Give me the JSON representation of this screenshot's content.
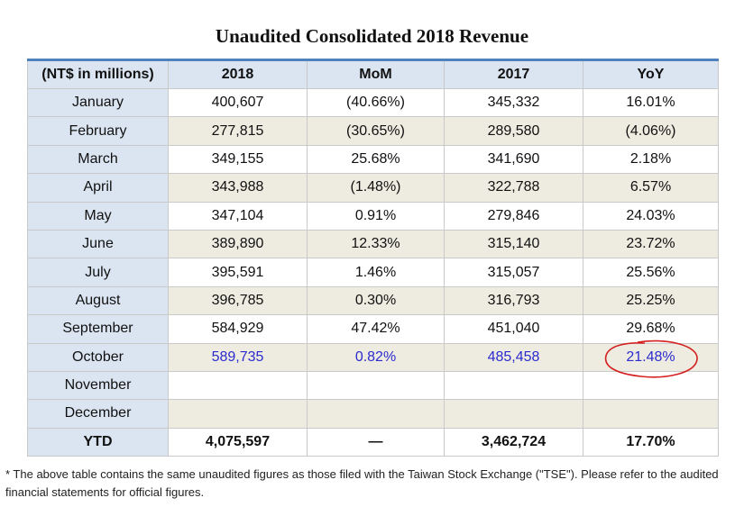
{
  "title": "Unaudited Consolidated 2018 Revenue",
  "table": {
    "headers": [
      "(NT$ in millions)",
      "2018",
      "MoM",
      "2017",
      "YoY"
    ],
    "rows": [
      {
        "month": "January",
        "y2018": "400,607",
        "mom": "(40.66%)",
        "y2017": "345,332",
        "yoy": "16.01%"
      },
      {
        "month": "February",
        "y2018": "277,815",
        "mom": "(30.65%)",
        "y2017": "289,580",
        "yoy": "(4.06%)"
      },
      {
        "month": "March",
        "y2018": "349,155",
        "mom": "25.68%",
        "y2017": "341,690",
        "yoy": "2.18%"
      },
      {
        "month": "April",
        "y2018": "343,988",
        "mom": "(1.48%)",
        "y2017": "322,788",
        "yoy": "6.57%"
      },
      {
        "month": "May",
        "y2018": "347,104",
        "mom": "0.91%",
        "y2017": "279,846",
        "yoy": "24.03%"
      },
      {
        "month": "June",
        "y2018": "389,890",
        "mom": "12.33%",
        "y2017": "315,140",
        "yoy": "23.72%"
      },
      {
        "month": "July",
        "y2018": "395,591",
        "mom": "1.46%",
        "y2017": "315,057",
        "yoy": "25.56%"
      },
      {
        "month": "August",
        "y2018": "396,785",
        "mom": "0.30%",
        "y2017": "316,793",
        "yoy": "25.25%"
      },
      {
        "month": "September",
        "y2018": "584,929",
        "mom": "47.42%",
        "y2017": "451,040",
        "yoy": "29.68%"
      },
      {
        "month": "October",
        "y2018": "589,735",
        "mom": "0.82%",
        "y2017": "485,458",
        "yoy": "21.48%",
        "highlight": true
      },
      {
        "month": "November",
        "y2018": "",
        "mom": "",
        "y2017": "",
        "yoy": ""
      },
      {
        "month": "December",
        "y2018": "",
        "mom": "",
        "y2017": "",
        "yoy": ""
      }
    ],
    "total": {
      "month": "YTD",
      "y2018": "4,075,597",
      "mom": "—",
      "y2017": "3,462,724",
      "yoy": "17.70%"
    }
  },
  "highlight_color": "#2b2bcf",
  "annotation_color": "#d42020",
  "footnote": "* The above table contains the same unaudited figures as those filed with the Taiwan Stock Exchange (\"TSE\"). Please refer to the audited financial statements for official figures."
}
